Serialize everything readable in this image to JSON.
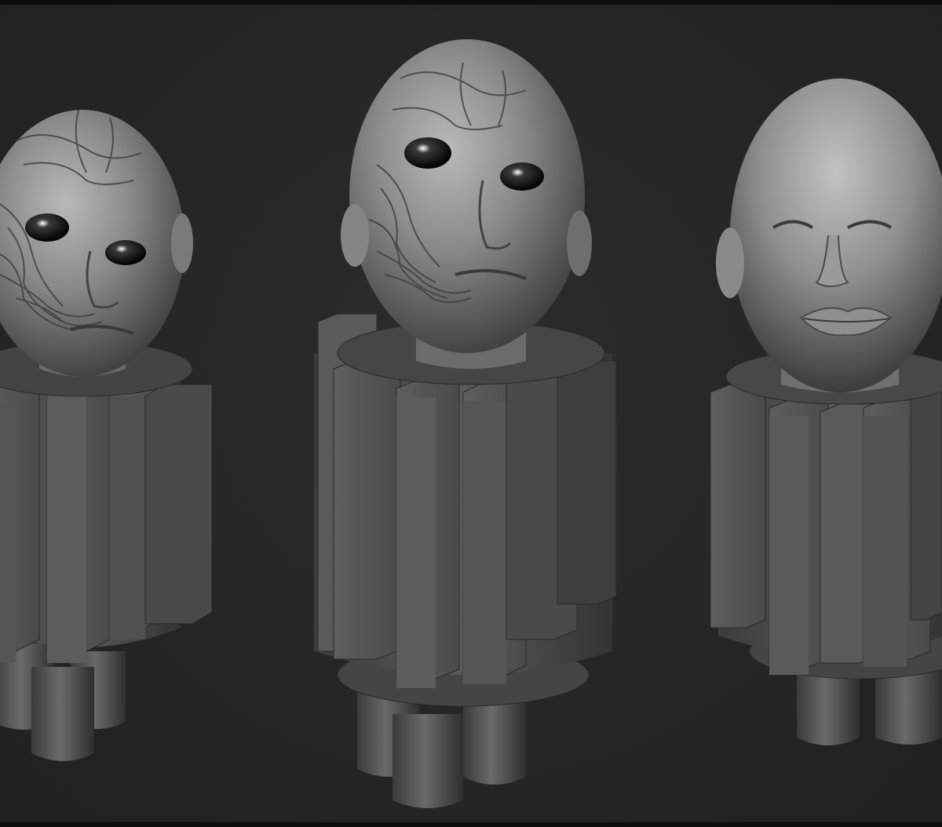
{
  "scene": {
    "background_color": "#262626",
    "material_color": "#7a7a7a",
    "models": [
      {
        "name": "bust-left",
        "variant": "decayed-face"
      },
      {
        "name": "bust-center",
        "variant": "decayed-face"
      },
      {
        "name": "bust-right",
        "variant": "smooth-face"
      }
    ]
  }
}
